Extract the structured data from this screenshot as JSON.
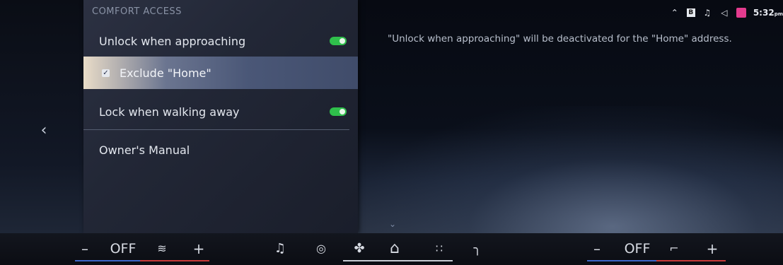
{
  "status_bar": {
    "icons": [
      "wifi-icon",
      "phone-icon",
      "music-note-icon",
      "volume-icon",
      "calendar-icon"
    ],
    "phone_badge": "B",
    "time": "5:32",
    "time_suffix": "pm"
  },
  "comfort_access": {
    "title": "COMFORT ACCESS",
    "items": [
      {
        "label": "Unlock when approaching",
        "toggle": true
      },
      {
        "label": "Exclude \"Home\"",
        "checked": true
      },
      {
        "label": "Lock when walking away",
        "toggle": true
      },
      {
        "label": "Owner's Manual"
      }
    ]
  },
  "info_text": "\"Unlock when approaching\" will be deactivated for the \"Home\" address.",
  "bottom_bar": {
    "left_climate": {
      "minus": "–",
      "value": "OFF",
      "plus": "+"
    },
    "right_climate": {
      "minus": "–",
      "value": "OFF",
      "plus": "+"
    },
    "shortcuts": [
      "music-icon",
      "navigation-icon",
      "fan-icon",
      "home-icon",
      "apps-icon",
      "phone-icon"
    ]
  },
  "colors": {
    "toggle_on": "#2fbf4b",
    "temp_cold": "#3d67c9",
    "temp_hot": "#c93a3a"
  }
}
